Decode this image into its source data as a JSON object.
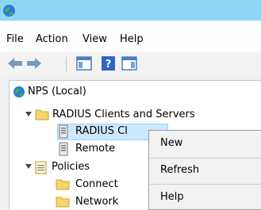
{
  "menubar": {
    "items": [
      {
        "label": "File"
      },
      {
        "label": "Action"
      },
      {
        "label": "View"
      },
      {
        "label": "Help"
      }
    ]
  },
  "tree": {
    "root": "NPS (Local)",
    "radius_group": "RADIUS Clients and Servers",
    "radius_clients": "RADIUS Cl",
    "remote": "Remote",
    "policies": "Policies",
    "connect": "Connect",
    "network": "Network"
  },
  "context_menu": {
    "items": [
      {
        "label": "New"
      },
      {
        "label": "Refresh"
      },
      {
        "label": "Help"
      }
    ]
  }
}
